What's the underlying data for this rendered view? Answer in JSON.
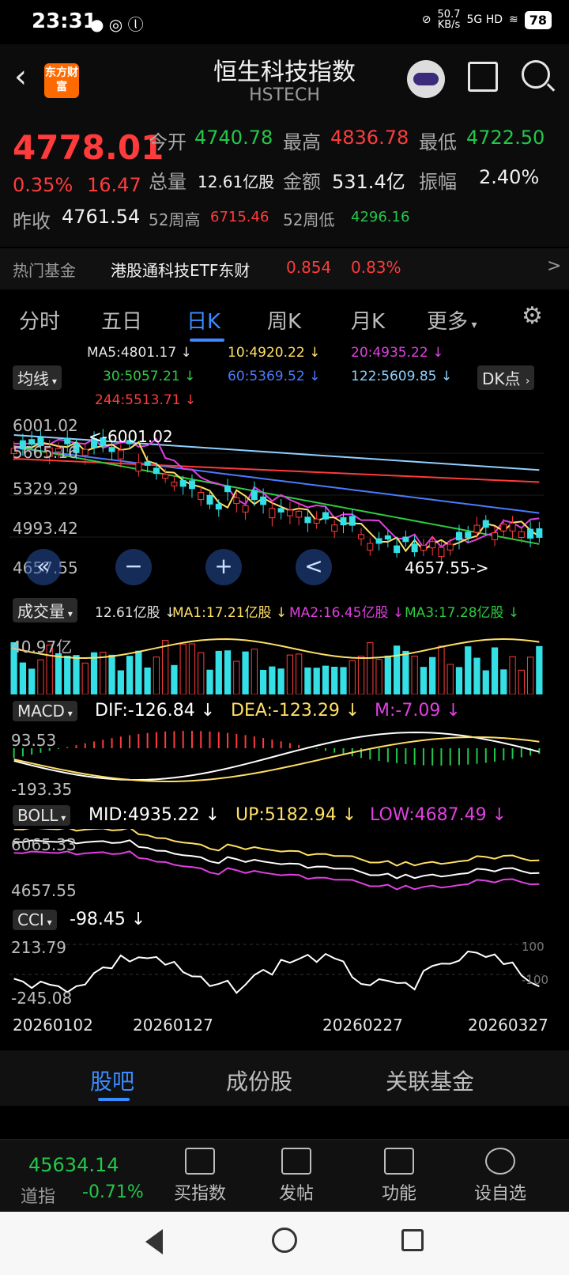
{
  "status_bar": {
    "time": "23:31",
    "net_speed": "50.7",
    "net_unit": "KB/s",
    "signal": "5G HD",
    "battery": "78"
  },
  "header": {
    "logo_text": "东方财富",
    "title": "恒生科技指数",
    "subtitle": "HSTECH"
  },
  "quote": {
    "price": "4778.01",
    "change_pct": "0.35%",
    "change": "16.47",
    "open_label": "今开",
    "open": "4740.78",
    "high_label": "最高",
    "high": "4836.78",
    "low_label": "最低",
    "low": "4722.50",
    "volume_label": "总量",
    "volume": "12.61亿股",
    "amount_label": "金额",
    "amount": "531.4亿",
    "amplitude_label": "振幅",
    "amplitude": "2.40%",
    "prev_close_label": "昨收",
    "prev_close": "4761.54",
    "wk52_high_label": "52周高",
    "wk52_high": "6715.46",
    "wk52_low_label": "52周低",
    "wk52_low": "4296.16"
  },
  "hot_fund": {
    "label": "热门基金",
    "name": "港股通科技ETF东财",
    "price": "0.854",
    "pct": "0.83%",
    "chevron": ">"
  },
  "tabs": [
    "分时",
    "五日",
    "日K",
    "周K",
    "月K",
    "更多"
  ],
  "ma_line": {
    "selector": "均线",
    "ma5": "MA5:4801.17",
    "ma10": "10:4920.22",
    "ma20": "20:4935.22",
    "ma30": "30:5057.21",
    "ma60": "60:5369.52",
    "ma122": "122:5609.85",
    "ma244": "244:5513.71",
    "dk": "DK点",
    "arrow": "↓"
  },
  "kline": {
    "axis": [
      "6001.02",
      "5665.16",
      "5329.29",
      "4993.42",
      "4657.55"
    ],
    "max_label": "<-6001.02",
    "min_label": "4657.55->",
    "zoom": [
      "«",
      "−",
      "+",
      "<"
    ]
  },
  "volume": {
    "selector": "成交量",
    "value": "12.61亿股",
    "ma1": "MA1:17.21亿股",
    "ma2": "MA2:16.45亿股",
    "ma3": "MA3:17.28亿股",
    "axis_top": "40.97亿"
  },
  "macd": {
    "selector": "MACD",
    "dif": "DIF:-126.84",
    "dea": "DEA:-123.29",
    "m": "M:-7.09",
    "axis_top": "93.53",
    "axis_bottom": "-193.35"
  },
  "boll": {
    "selector": "BOLL",
    "mid": "MID:4935.22",
    "up": "UP:5182.94",
    "low": "LOW:4687.49",
    "axis_top": "6065.33",
    "axis_bottom": "4657.55"
  },
  "cci": {
    "selector": "CCI",
    "value": "-98.45",
    "axis_top": "213.79",
    "axis_bottom": "-245.08",
    "ref_hi": "100",
    "ref_lo": "-100"
  },
  "dates": [
    "20260102",
    "20260127",
    "20260227",
    "20260327"
  ],
  "bottom_tabs": [
    "股吧",
    "成份股",
    "关联基金"
  ],
  "bottom_bar": {
    "index_value": "45634.14",
    "index_name": "道指",
    "index_pct": "-0.71%",
    "items": [
      "买指数",
      "发帖",
      "功能",
      "设自选"
    ]
  },
  "colors": {
    "up": "#ff3b3b",
    "down": "#22c84a",
    "accent": "#3a8bff",
    "candle_down": "#34e0e6"
  }
}
